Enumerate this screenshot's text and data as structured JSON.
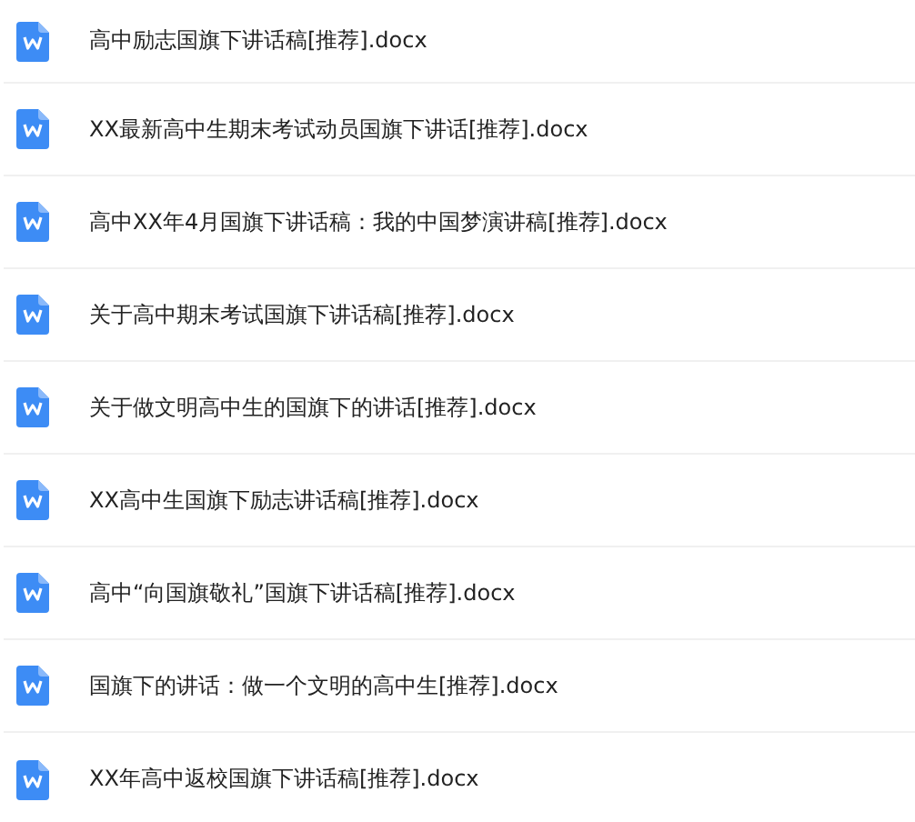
{
  "files": [
    {
      "name": "高中励志国旗下讲话稿[推荐].docx"
    },
    {
      "name": "XX最新高中生期末考试动员国旗下讲话[推荐].docx"
    },
    {
      "name": "高中XX年4月国旗下讲话稿：我的中国梦演讲稿[推荐].docx"
    },
    {
      "name": "关于高中期末考试国旗下讲话稿[推荐].docx"
    },
    {
      "name": "关于做文明高中生的国旗下的讲话[推荐].docx"
    },
    {
      "name": "XX高中生国旗下励志讲话稿[推荐].docx"
    },
    {
      "name": "高中“向国旗敬礼”国旗下讲话稿[推荐].docx"
    },
    {
      "name": "国旗下的讲话：做一个文明的高中生[推荐].docx"
    },
    {
      "name": "XX年高中返校国旗下讲话稿[推荐].docx"
    }
  ]
}
